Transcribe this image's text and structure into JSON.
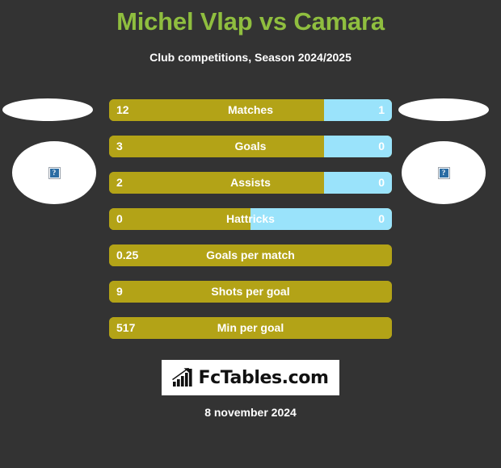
{
  "header": {
    "title": "Michel Vlap vs Camara",
    "subtitle": "Club competitions, Season 2024/2025",
    "title_color": "#8fbe3f"
  },
  "players": {
    "home": {
      "photo_alt": "broken-image",
      "placeholder_glyph": "?"
    },
    "away": {
      "photo_alt": "broken-image",
      "placeholder_glyph": "?"
    }
  },
  "colors": {
    "background": "#333333",
    "home_bar": "#b3a317",
    "away_bar": "#9ae3fb",
    "text": "#ffffff"
  },
  "chart_data": {
    "type": "bar",
    "title": "Michel Vlap vs Camara",
    "subtitle": "Club competitions, Season 2024/2025",
    "orientation": "horizontal-diverging",
    "categories": [
      "Matches",
      "Goals",
      "Assists",
      "Hattricks",
      "Goals per match",
      "Shots per goal",
      "Min per goal"
    ],
    "series": [
      {
        "name": "Michel Vlap",
        "values": [
          "12",
          "3",
          "2",
          "0",
          "0.25",
          "9",
          "517"
        ]
      },
      {
        "name": "Camara",
        "values": [
          "1",
          "0",
          "0",
          "0",
          "",
          "",
          ""
        ]
      }
    ],
    "rows": [
      {
        "label": "Matches",
        "home": "12",
        "away": "1",
        "home_pct": 76,
        "split": true
      },
      {
        "label": "Goals",
        "home": "3",
        "away": "0",
        "home_pct": 76,
        "split": true
      },
      {
        "label": "Assists",
        "home": "2",
        "away": "0",
        "home_pct": 76,
        "split": true
      },
      {
        "label": "Hattricks",
        "home": "0",
        "away": "0",
        "home_pct": 50,
        "split": true
      },
      {
        "label": "Goals per match",
        "home": "0.25",
        "away": "",
        "home_pct": 100,
        "split": false
      },
      {
        "label": "Shots per goal",
        "home": "9",
        "away": "",
        "home_pct": 100,
        "split": false
      },
      {
        "label": "Min per goal",
        "home": "517",
        "away": "",
        "home_pct": 100,
        "split": false
      }
    ]
  },
  "logo": {
    "text": "FcTables.com",
    "icon": "bar-chart-growth-icon"
  },
  "footer": {
    "date": "8 november 2024"
  }
}
